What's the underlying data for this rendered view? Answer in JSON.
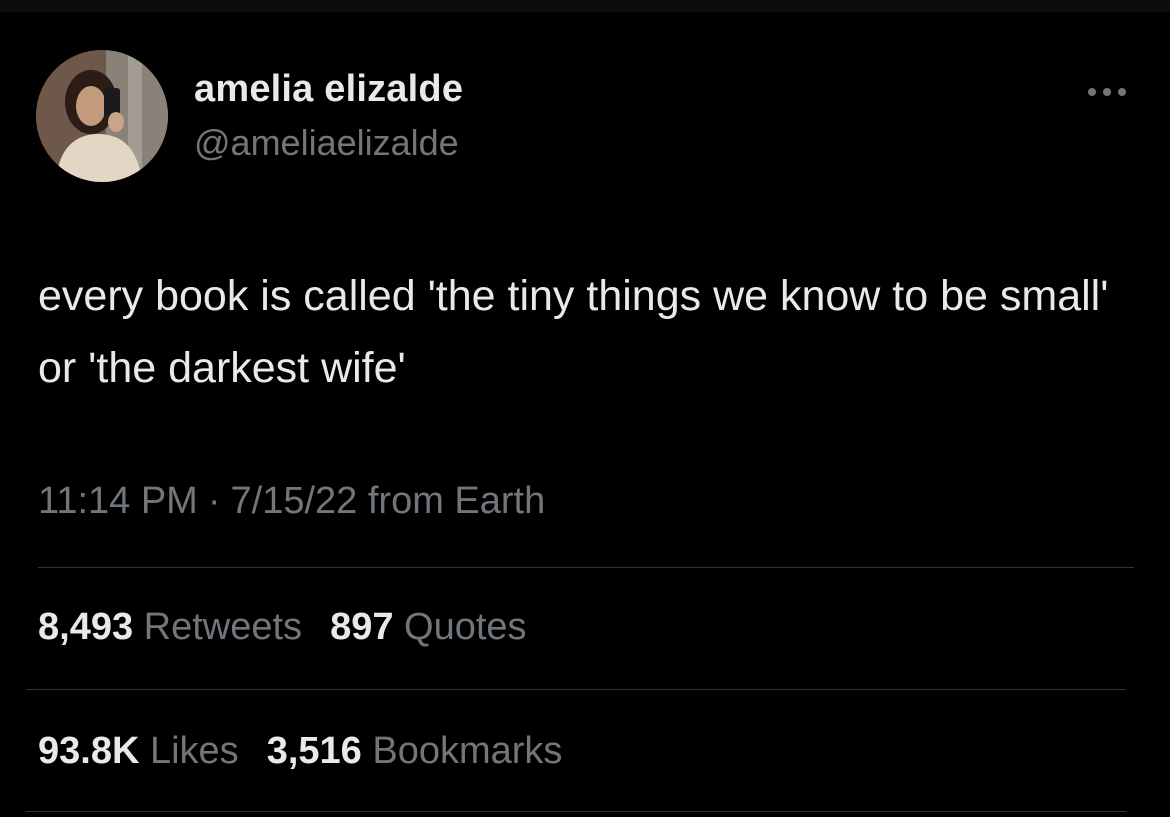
{
  "author": {
    "name": "amelia elizalde",
    "handle": "@ameliaelizalde"
  },
  "tweet": {
    "text": "every book is called 'the tiny things we know to be small' or 'the darkest wife'",
    "time": "11:14 PM",
    "separator": "·",
    "date": "7/15/22",
    "source": "from Earth"
  },
  "stats": {
    "retweets": {
      "count": "8,493",
      "label": "Retweets"
    },
    "quotes": {
      "count": "897",
      "label": "Quotes"
    },
    "likes": {
      "count": "93.8K",
      "label": "Likes"
    },
    "bookmarks": {
      "count": "3,516",
      "label": "Bookmarks"
    }
  },
  "icons": {
    "more": "more-horizontal-icon"
  },
  "colors": {
    "background": "#000000",
    "text_primary": "#e7e9ea",
    "text_secondary": "#71767b",
    "divider": "#2f3336"
  }
}
